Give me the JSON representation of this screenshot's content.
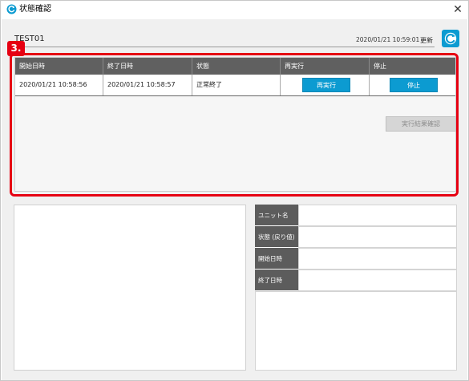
{
  "window": {
    "title": "状態確認",
    "close_glyph": "✕"
  },
  "header": {
    "job_name": "TEST01",
    "timestamp": "2020/01/21 10:59:01",
    "update_label": "更新"
  },
  "annotation": {
    "step_badge": "3."
  },
  "grid": {
    "columns": [
      "開始日時",
      "終了日時",
      "状態",
      "再実行",
      "停止"
    ],
    "rows": [
      {
        "start": "2020/01/21 10:58:56",
        "end": "2020/01/21 10:58:57",
        "status": "正常終了",
        "rerun_label": "再実行",
        "stop_label": "停止"
      }
    ]
  },
  "details": {
    "unit_name_label": "ユニット名",
    "unit_name_value": "",
    "status_label": "状態 (戻り値)",
    "status_value": "",
    "start_label": "開始日時",
    "start_value": "",
    "end_label": "終了日時",
    "end_value": ""
  },
  "actions": {
    "result_confirm_label": "実行結果確認"
  },
  "colors": {
    "accent": "#0c9bd1",
    "highlight": "#e60012",
    "header_bg": "#606060"
  },
  "icons": {
    "title_icon": "refresh-circle-icon",
    "refresh_icon": "refresh-icon",
    "close_icon": "close-icon"
  }
}
